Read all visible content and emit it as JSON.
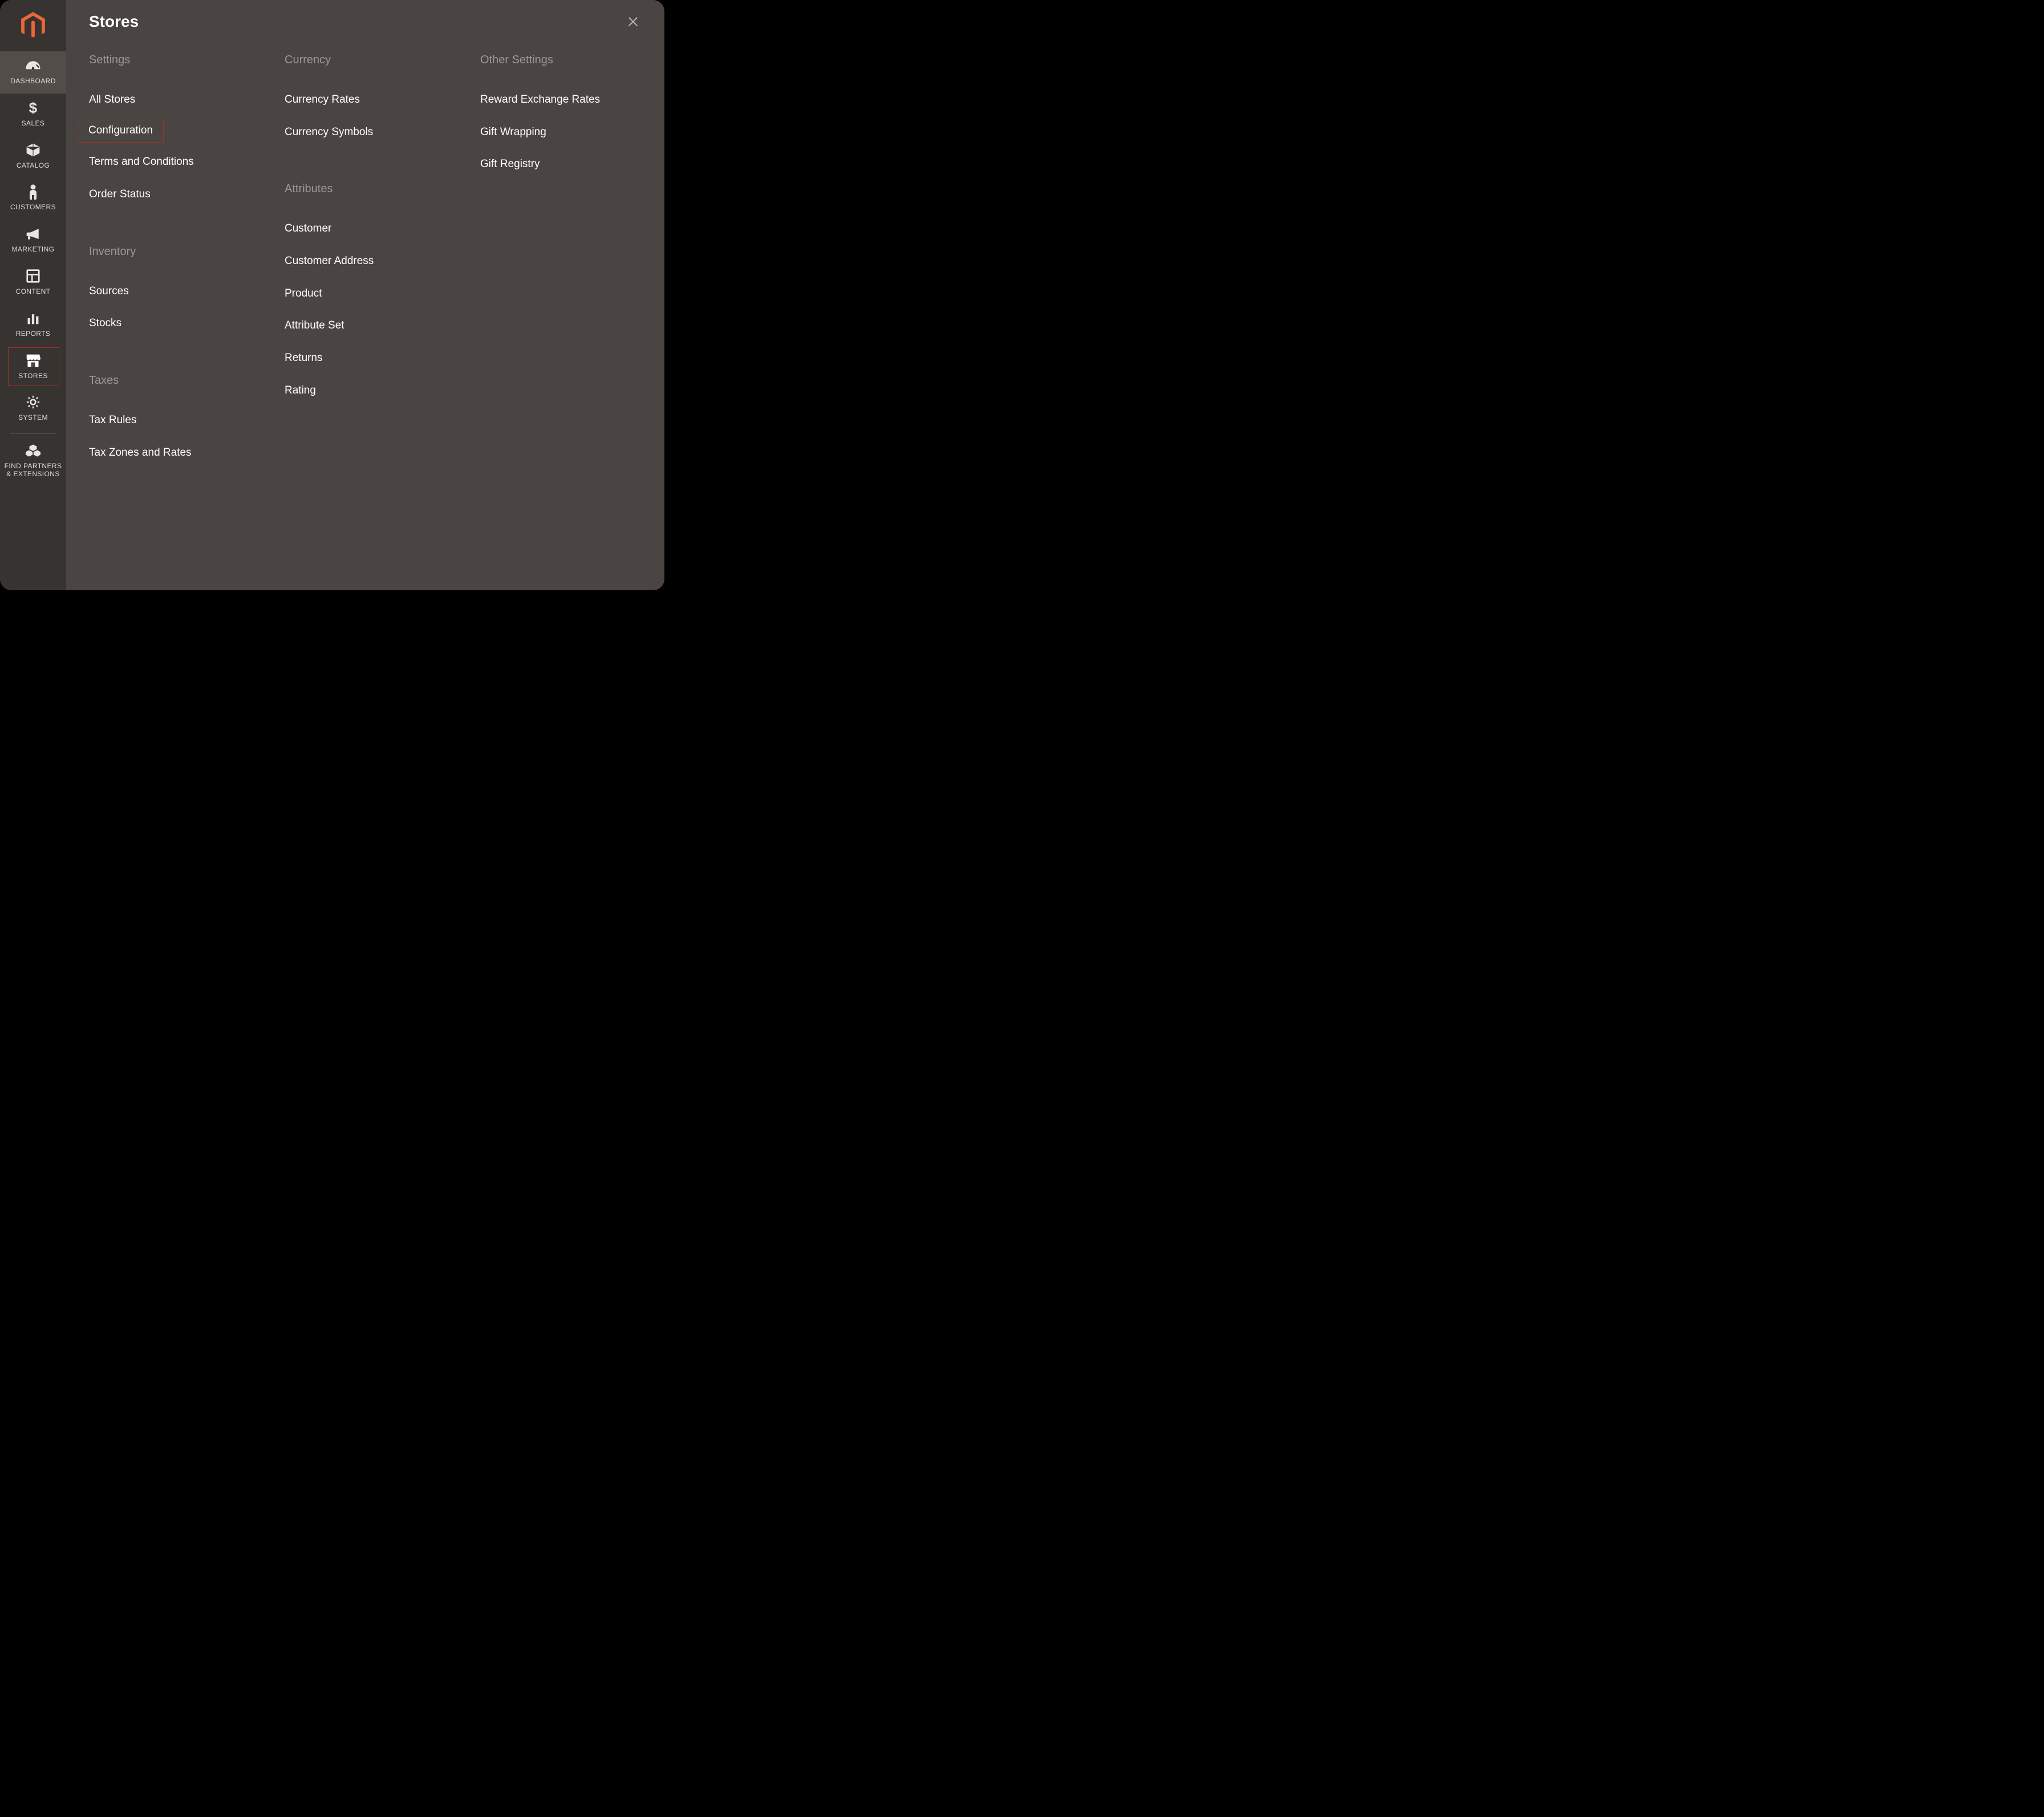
{
  "sidebar": {
    "items": [
      {
        "label": "DASHBOARD",
        "icon": "gauge-icon",
        "active": true,
        "highlighted": false
      },
      {
        "label": "SALES",
        "icon": "dollar-icon"
      },
      {
        "label": "CATALOG",
        "icon": "box-icon"
      },
      {
        "label": "CUSTOMERS",
        "icon": "person-icon"
      },
      {
        "label": "MARKETING",
        "icon": "megaphone-icon"
      },
      {
        "label": "CONTENT",
        "icon": "layout-icon"
      },
      {
        "label": "REPORTS",
        "icon": "bars-icon"
      },
      {
        "label": "STORES",
        "icon": "store-icon",
        "highlighted": true
      },
      {
        "label": "SYSTEM",
        "icon": "gear-icon"
      },
      {
        "label": "FIND PARTNERS & EXTENSIONS",
        "icon": "cubes-icon",
        "divider_before": true
      }
    ]
  },
  "flyout": {
    "title": "Stores",
    "columns": [
      {
        "groups": [
          {
            "title": "Settings",
            "items": [
              {
                "label": "All Stores"
              },
              {
                "label": "Configuration",
                "highlighted": true
              },
              {
                "label": "Terms and Conditions"
              },
              {
                "label": "Order Status"
              }
            ]
          },
          {
            "title": "Inventory",
            "items": [
              {
                "label": "Sources"
              },
              {
                "label": "Stocks"
              }
            ]
          },
          {
            "title": "Taxes",
            "items": [
              {
                "label": "Tax Rules"
              },
              {
                "label": "Tax Zones and Rates"
              }
            ]
          }
        ]
      },
      {
        "groups": [
          {
            "title": "Currency",
            "items": [
              {
                "label": "Currency Rates"
              },
              {
                "label": "Currency Symbols"
              }
            ]
          },
          {
            "title": "Attributes",
            "items": [
              {
                "label": "Customer"
              },
              {
                "label": "Customer Address"
              },
              {
                "label": "Product"
              },
              {
                "label": "Attribute Set"
              },
              {
                "label": "Returns"
              },
              {
                "label": "Rating"
              }
            ]
          }
        ]
      },
      {
        "groups": [
          {
            "title": "Other Settings",
            "items": [
              {
                "label": "Reward Exchange Rates"
              },
              {
                "label": "Gift Wrapping"
              },
              {
                "label": "Gift Registry"
              }
            ]
          }
        ]
      }
    ]
  },
  "colors": {
    "accent": "#e9672c",
    "highlight_border": "#a62f27",
    "sidebar_bg": "#373330",
    "flyout_bg": "#4a4542"
  }
}
